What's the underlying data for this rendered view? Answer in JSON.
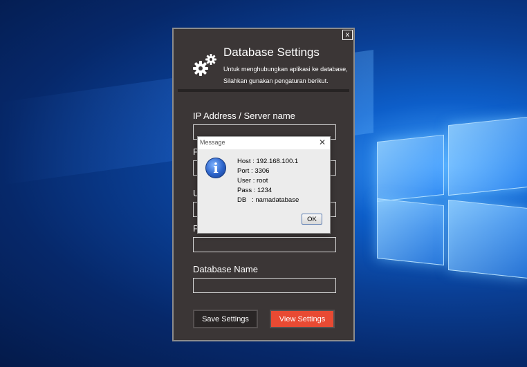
{
  "window": {
    "close_label": "x",
    "title": "Database Settings",
    "subtitle_line1": "Untuk menghubungkan aplikasi ke database,",
    "subtitle_line2": "Silahkan gunakan pengaturan berikut.",
    "icon": "gears-icon"
  },
  "fields": [
    {
      "label": "IP Address / Server name",
      "value": ""
    },
    {
      "label": "P",
      "value": ""
    },
    {
      "label": "U",
      "value": ""
    },
    {
      "label": "P",
      "value": ""
    },
    {
      "label": "Database Name",
      "value": ""
    }
  ],
  "buttons": {
    "save": "Save Settings",
    "view": "View Settings"
  },
  "dialog": {
    "title": "Message",
    "close": "✕",
    "icon": "info-icon",
    "icon_glyph": "i",
    "lines": [
      "Host : 192.168.100.1",
      "Port : 3306",
      "User : root",
      "Pass : 1234",
      "DB   : namadatabase"
    ],
    "ok_label": "OK"
  },
  "colors": {
    "window_bg": "#3b3636",
    "accent_button": "#e84a33",
    "desktop_blue": "#0a3f95"
  }
}
